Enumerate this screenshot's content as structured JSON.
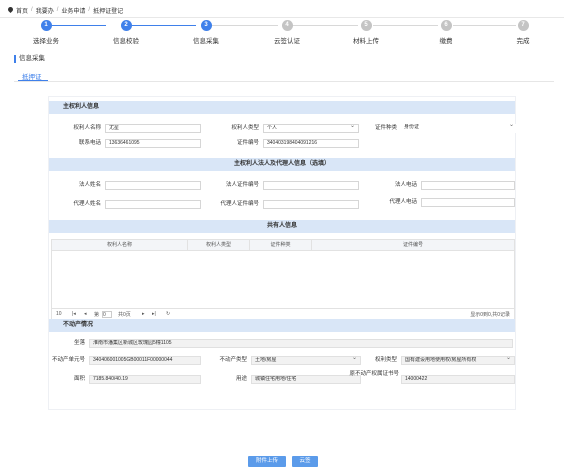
{
  "breadcrumb": {
    "home": "首页",
    "items": [
      "我要办",
      "业务申请",
      "抵押证登记"
    ]
  },
  "steps": [
    {
      "num": "1",
      "label": "选择业务",
      "status": "done"
    },
    {
      "num": "2",
      "label": "信息校验",
      "status": "done"
    },
    {
      "num": "3",
      "label": "信息采集",
      "status": "done"
    },
    {
      "num": "4",
      "label": "云签认证",
      "status": "todo"
    },
    {
      "num": "5",
      "label": "材料上传",
      "status": "todo"
    },
    {
      "num": "6",
      "label": "缴费",
      "status": "todo"
    },
    {
      "num": "7",
      "label": "完成",
      "status": "todo"
    }
  ],
  "section_title": "信息采集",
  "tab": "抵押证",
  "main_party": {
    "title": "主权利人信息",
    "name_label": "权利人名称",
    "name_value": "尤星",
    "type_label": "权利人类型",
    "type_value": "个人",
    "cert_type_label": "证件种类",
    "cert_type_value": "身份证",
    "phone_label": "联系电话",
    "phone_value": "13636461095",
    "cert_no_label": "证件编号",
    "cert_no_value": "340403198404091216"
  },
  "legal_agent": {
    "title": "主权利人法人及代理人信息（选填）",
    "legal_name_label": "法人姓名",
    "legal_cert_label": "法人证件编号",
    "legal_phone_label": "法人电话",
    "agent_name_label": "代理人姓名",
    "agent_cert_label": "代理人证件编号",
    "agent_phone_label": "代理人电话"
  },
  "co_owner": {
    "title": "共有人信息",
    "columns": [
      "权利人名称",
      "权利人类型",
      "证件种类",
      "证件编号"
    ],
    "pager": {
      "page_size": "10",
      "first": "|◂",
      "prev": "◂",
      "page_label": "第",
      "page_value": "0",
      "total": "共0页",
      "next": "▸",
      "last": "▸|",
      "refresh": "↻",
      "summary": "显示0到0,共0记录"
    }
  },
  "property": {
    "title": "不动产情况",
    "location_label": "坐落",
    "location_value": "淮南市潘集区新城区玫瑰园5幢1105",
    "unit_label": "不动产单元号",
    "unit_value": "340406001005GB00011F00000044",
    "ptype_label": "不动产类型",
    "ptype_value": "土地/房屋",
    "rtype_label": "权利类型",
    "rtype_value": "国有建设用地使用权/房屋所有权",
    "area_label": "面积",
    "area_value": "7185.840/40.19",
    "use_label": "用途",
    "use_value": "城镇住宅用地/住宅",
    "cert_label": "原不动产权属证书号",
    "cert_value": "14000422"
  },
  "buttons": {
    "upload": "附件上传",
    "sign": "云签"
  }
}
